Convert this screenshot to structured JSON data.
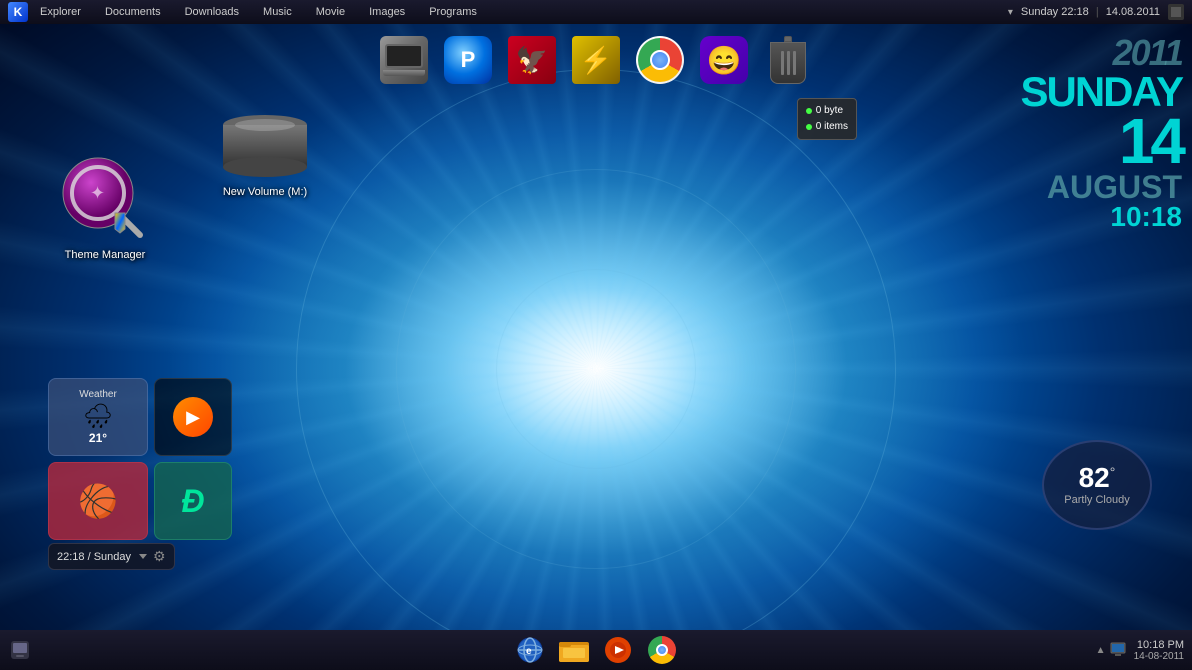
{
  "desktop": {
    "background_description": "blue radial light burst desktop"
  },
  "top_taskbar": {
    "logo_label": "▣",
    "menu_items": [
      "Explorer",
      "Documents",
      "Downloads",
      "Music",
      "Movie",
      "Images",
      "Programs"
    ],
    "time": "Sunday 22:18",
    "separator": "|",
    "date": "14.08.2011",
    "dropdown_arrow": "▾"
  },
  "dock_icons": [
    {
      "id": "laptop",
      "label": "",
      "emoji": "💻"
    },
    {
      "id": "blue-arrow",
      "label": "",
      "emoji": "🔵"
    },
    {
      "id": "phoenix",
      "label": "",
      "emoji": "🔴"
    },
    {
      "id": "warp",
      "label": "",
      "emoji": "⚡"
    },
    {
      "id": "chrome",
      "label": "",
      "emoji": "🌐"
    },
    {
      "id": "yahoo",
      "label": "",
      "emoji": "😁"
    },
    {
      "id": "trash",
      "label": "",
      "emoji": "🗑️"
    }
  ],
  "trash_tooltip": {
    "line1_dot": "●",
    "line1_text": "0 byte",
    "line2_dot": "●",
    "line2_text": "0 items"
  },
  "theme_manager": {
    "label": "Theme Manager"
  },
  "new_volume": {
    "label": "New Volume (M:)"
  },
  "weather_widget": {
    "label": "Weather",
    "icon": "🌧",
    "temp": "21°"
  },
  "media_widget": {
    "icon": "▶"
  },
  "social_widget": {
    "icon": "🏀"
  },
  "deviantart_widget": {
    "icon": "Ð"
  },
  "clock_widget": {
    "time": "22:18 / Sunday",
    "dropdown": "▾",
    "gear": "⚙"
  },
  "weather_br": {
    "temp": "82",
    "degree_symbol": "°",
    "label": "Partly Cloudy"
  },
  "datetime": {
    "year": "2011",
    "day_name": "SUNDAY",
    "day_num": "14",
    "month": "AUGUST",
    "time": "10:18"
  },
  "bottom_taskbar": {
    "left_icon": "❑",
    "center_icons": [
      {
        "id": "ie",
        "emoji": "🌐",
        "color": "#2060c0"
      },
      {
        "id": "folder",
        "emoji": "📁",
        "color": "#f0a000"
      },
      {
        "id": "media",
        "emoji": "▶",
        "color": "#e04000"
      },
      {
        "id": "chrome",
        "emoji": "🌐",
        "color": "#e0a000"
      }
    ],
    "right_tray_icons": [
      "▲",
      "🖥"
    ],
    "time": "10:18 PM",
    "date": "14-08-2011"
  }
}
